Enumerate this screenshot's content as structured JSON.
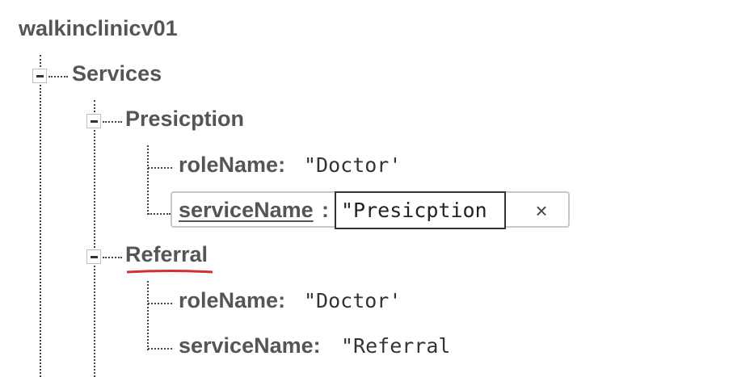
{
  "root": {
    "label": "walkinclinicv01"
  },
  "services": {
    "label": "Services",
    "presicption": {
      "label": "Presicption",
      "role_key": "roleName",
      "role_value": "\"Doctor'",
      "service_key": "serviceName",
      "service_value": "\"Presicption",
      "close_icon": "×"
    },
    "referral": {
      "label": "Referral",
      "role_key": "roleName",
      "role_value": "\"Doctor'",
      "service_key": "serviceName",
      "service_value": "\"Referral"
    }
  },
  "colors": {
    "text": "#555555",
    "value_text": "#333333",
    "connector": "#444444",
    "spellcheck_underline": "#d32f2f"
  },
  "icons": {
    "collapse": "minus-square-icon",
    "close": "close-icon"
  }
}
